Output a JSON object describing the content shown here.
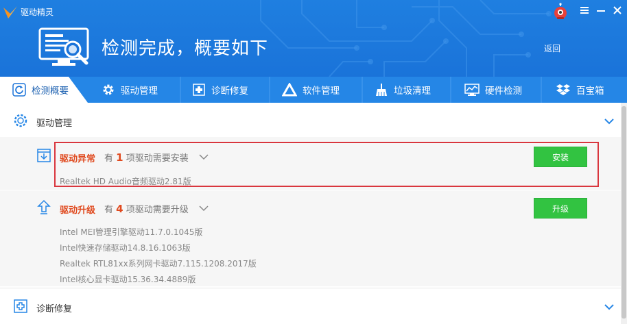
{
  "window": {
    "title": "驱动精灵"
  },
  "header": {
    "headline": "检测完成，概要如下",
    "back_label": "返回"
  },
  "tabs": [
    {
      "label": "检测概要",
      "icon": "refresh-icon",
      "active": true
    },
    {
      "label": "驱动管理",
      "icon": "gear-icon"
    },
    {
      "label": "诊断修复",
      "icon": "first-aid-icon"
    },
    {
      "label": "软件管理",
      "icon": "triangle-logo-icon"
    },
    {
      "label": "垃圾清理",
      "icon": "broom-icon"
    },
    {
      "label": "硬件检测",
      "icon": "monitor-chart-icon"
    },
    {
      "label": "百宝箱",
      "icon": "dropbox-icon"
    }
  ],
  "sections": {
    "driver_management": {
      "label": "驱动管理"
    },
    "diagnosis": {
      "label": "诊断修复"
    }
  },
  "groups": {
    "abnormal": {
      "title": "驱动异常",
      "prefix": "有",
      "count": "1",
      "suffix": "项驱动需要安装",
      "button": "安装",
      "drivers": [
        "Realtek HD Audio音频驱动2.81版"
      ]
    },
    "upgrade": {
      "title": "驱动升级",
      "prefix": "有",
      "count": "4",
      "suffix": "项驱动需要升级",
      "button": "升级",
      "drivers": [
        "Intel MEI管理引擎驱动11.7.0.1045版",
        "Intel快速存储驱动14.8.16.1063版",
        "Realtek RTL81xx系列网卡驱动7.115.1208.2017版",
        "Intel核心显卡驱动15.36.34.4889版"
      ]
    }
  },
  "colors": {
    "brand_blue": "#1a73d9",
    "tab_bar": "#2586e6",
    "alert": "#e04a1f",
    "button_green": "#32c341",
    "highlight_border": "#d9363e"
  }
}
